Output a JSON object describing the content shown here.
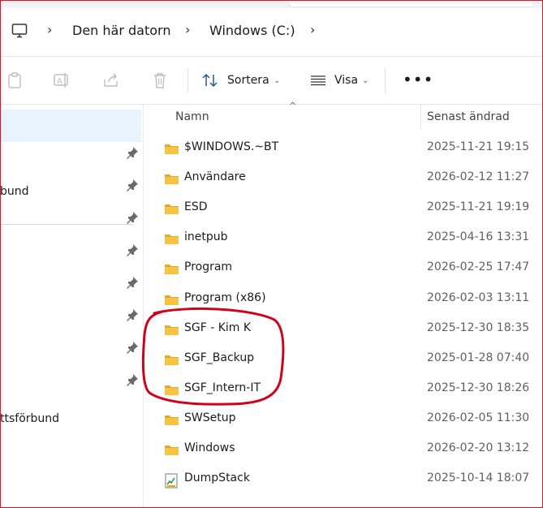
{
  "breadcrumb": {
    "items": [
      "Den här datorn",
      "Windows (C:)"
    ]
  },
  "toolbar": {
    "sort_label": "Sortera",
    "view_label": "Visa",
    "more_label": "•••"
  },
  "nav": {
    "items": [
      {
        "label": ""
      },
      {
        "label": "bund"
      },
      {
        "label": "ttsförbund"
      }
    ]
  },
  "columns": {
    "name": "Namn",
    "date": "Senast ändrad"
  },
  "files": [
    {
      "name": "$WINDOWS.~BT",
      "date": "2025-11-21 19:15",
      "icon": "folder-icon"
    },
    {
      "name": "Användare",
      "date": "2026-02-12 11:27",
      "icon": "folder-icon"
    },
    {
      "name": "ESD",
      "date": "2025-11-21 19:19",
      "icon": "folder-icon"
    },
    {
      "name": "inetpub",
      "date": "2025-04-16 13:31",
      "icon": "folder-icon"
    },
    {
      "name": "Program",
      "date": "2026-02-25 17:47",
      "icon": "folder-icon"
    },
    {
      "name": "Program (x86)",
      "date": "2026-02-03 13:11",
      "icon": "folder-icon"
    },
    {
      "name": "SGF - Kim K",
      "date": "2025-12-30 18:35",
      "icon": "folder-icon"
    },
    {
      "name": "SGF_Backup",
      "date": "2025-01-28 07:40",
      "icon": "folder-icon"
    },
    {
      "name": "SGF_Intern-IT",
      "date": "2025-12-30 18:26",
      "icon": "folder-icon"
    },
    {
      "name": "SWSetup",
      "date": "2026-02-05 11:30",
      "icon": "folder-icon"
    },
    {
      "name": "Windows",
      "date": "2026-02-20 13:12",
      "icon": "folder-icon"
    },
    {
      "name": "DumpStack",
      "date": "2025-10-14 18:07",
      "icon": "log-file-icon"
    }
  ],
  "colors": {
    "folder": "#f6c343",
    "folder_dark": "#e0a92b",
    "selection": "#e9f3fd",
    "annotation": "#d0021b",
    "frame": "#e81123"
  }
}
